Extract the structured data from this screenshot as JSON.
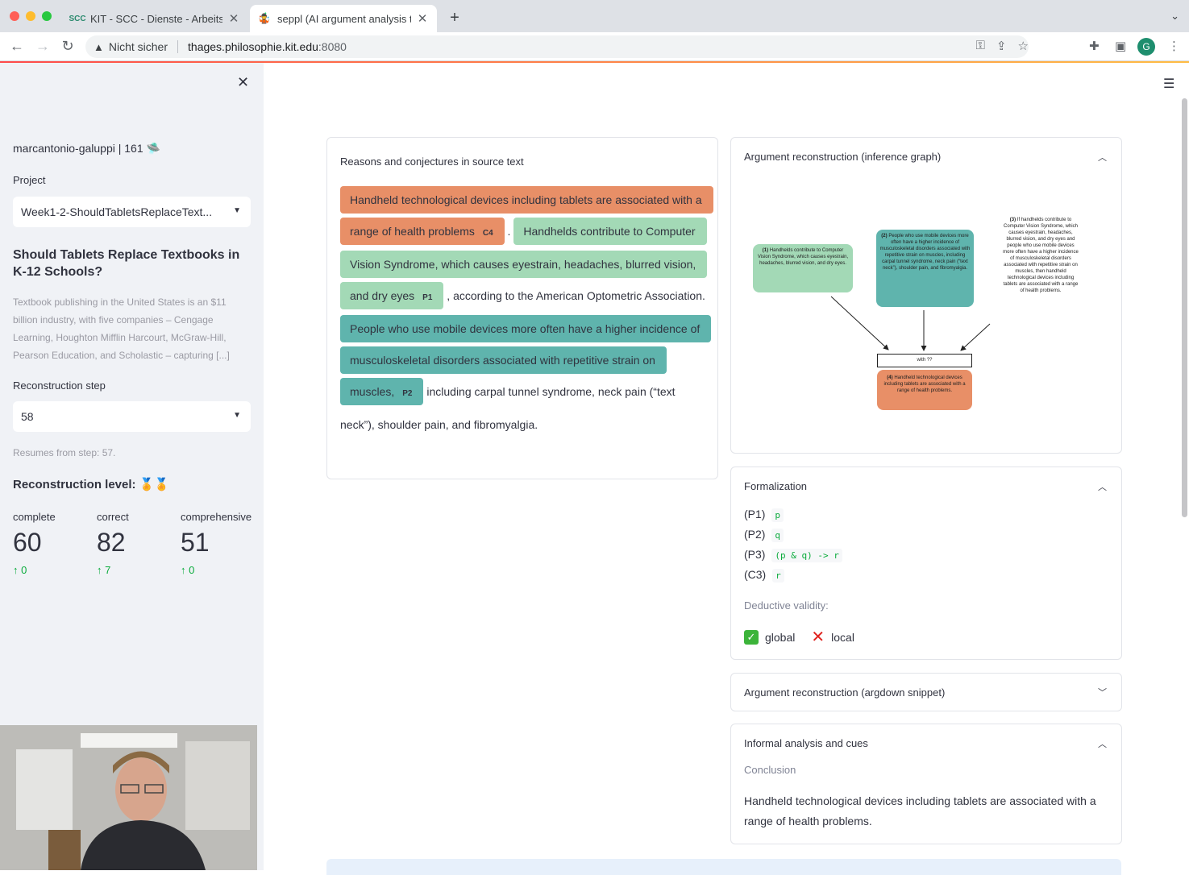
{
  "browser": {
    "tabs": [
      {
        "label": "KIT - SCC - Dienste - Arbeitsu",
        "icon": "scc-favicon"
      },
      {
        "label": "seppl (AI argument analysis tut",
        "icon": "seppl-favicon"
      }
    ],
    "insecure_label": "Nicht sicher",
    "url_host": "thages.philosophie.kit.edu",
    "url_port": ":8080",
    "profile_initial": "G"
  },
  "sidebar": {
    "user": "marcantonio-galuppi | 161 🛸",
    "project_label": "Project",
    "project_value": "Week1-2-ShouldTabletsReplaceText...",
    "title": "Should Tablets Replace Textbooks in K-12 Schools?",
    "description": "Textbook publishing in the United States is an $11 billion industry, with five companies – Cengage Learning, Houghton Mifflin Harcourt, McGraw-Hill, Pearson Education, and Scholastic – capturing [...]",
    "step_label": "Reconstruction step",
    "step_value": "58",
    "resumes": "Resumes from step: 57.",
    "level_label": "Reconstruction level:",
    "level_medals": "🏅🏅",
    "metrics": [
      {
        "label": "complete",
        "value": "60",
        "delta": "0"
      },
      {
        "label": "correct",
        "value": "82",
        "delta": "7"
      },
      {
        "label": "comprehensive",
        "value": "51",
        "delta": "0"
      }
    ]
  },
  "source": {
    "header": "Reasons and conjectures in source text",
    "c4_text": "Handheld technological devices including tablets are associated with a range of health problems",
    "c4_tag": "C4",
    "after_c4": " .",
    "p1_text": "Handhelds contribute to Computer Vision Syndrome, which causes eyestrain, headaches, blurred vision, and dry eyes",
    "p1_tag": "P1",
    "after_p1": " , according to the American Optometric Association. ",
    "p2_text": "People who use mobile devices more often have a higher incidence of musculoskeletal disorders associated with repetitive strain on muscles,",
    "p2_tag": "P2",
    "after_p2": " including carpal tunnel syndrome, neck pain (“text neck”), shoulder pain, and fibromyalgia."
  },
  "graph": {
    "header": "Argument reconstruction (inference graph)",
    "node1_num": "(1)",
    "node1": "Handhelds contribute to Computer Vision Syndrome, which causes eyestrain, headaches, blurred vision, and dry eyes.",
    "node2_num": "(2)",
    "node2": "People who use mobile devices more often have a higher incidence of musculoskeletal disorders associated with repetitive strain on muscles, including carpal tunnel syndrome, neck pain (“text neck”), shoulder pain, and fibromyalgia.",
    "node3_num": "(3)",
    "node3": "If handhelds contribute to Computer Vision Syndrome, which causes eyestrain, headaches, blurred vision, and dry eyes and people who use mobile devices more often have a higher incidence of musculoskeletal disorders associated with repetitive strain on muscles, then handheld technological devices including tablets are associated with a range of health problems.",
    "with": "with ??",
    "node4_num": "(4)",
    "node4": "Handheld technological devices including tablets are associated with a range of health problems."
  },
  "formalization": {
    "header": "Formalization",
    "rows": [
      {
        "label": "(P1)",
        "code": "p"
      },
      {
        "label": "(P2)",
        "code": "q"
      },
      {
        "label": "(P3)",
        "code": "(p & q) -> r"
      },
      {
        "label": "(C3)",
        "code": "r"
      }
    ],
    "validity_label": "Deductive validity:",
    "global": "global",
    "local": "local"
  },
  "argdown": {
    "header": "Argument reconstruction (argdown snippet)"
  },
  "informal": {
    "header": "Informal analysis and cues",
    "conclusion_label": "Conclusion",
    "conclusion": "Handheld technological devices including tablets are associated with a range of health problems."
  },
  "colors": {
    "c4": "#e88f67",
    "p1": "#a3d9b6",
    "p2": "#5fb4ad",
    "accent": "#ff4b4b"
  }
}
